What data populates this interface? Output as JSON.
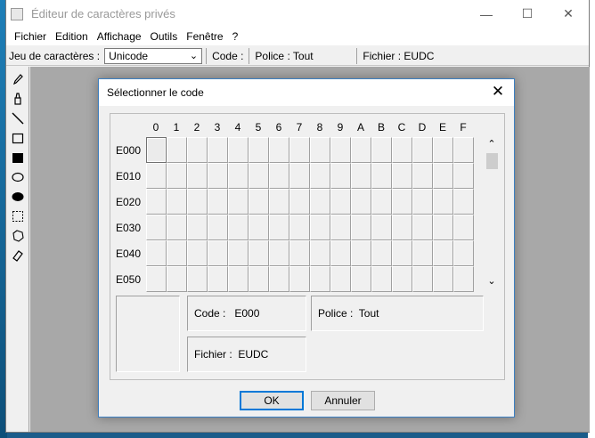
{
  "window": {
    "title": "Éditeur de caractères privés",
    "controls": {
      "minimize": "—",
      "maximize": "☐",
      "close": "✕"
    }
  },
  "menu": [
    "Fichier",
    "Edition",
    "Affichage",
    "Outils",
    "Fenêtre",
    "?"
  ],
  "toolbar": {
    "charset_label": "Jeu de caractères :",
    "charset_value": "Unicode",
    "code_label": "Code :",
    "font_label": "Police : Tout",
    "file_label": "Fichier : EUDC"
  },
  "tools": [
    "pencil-icon",
    "brush-icon",
    "line-icon",
    "hollow-rectangle-icon",
    "filled-rectangle-icon",
    "hollow-ellipse-icon",
    "filled-ellipse-icon",
    "rectangular-selection-icon",
    "freeform-selection-icon",
    "eraser-icon"
  ],
  "dialog": {
    "title": "Sélectionner le code",
    "close": "✕",
    "columns": [
      "0",
      "1",
      "2",
      "3",
      "4",
      "5",
      "6",
      "7",
      "8",
      "9",
      "A",
      "B",
      "C",
      "D",
      "E",
      "F"
    ],
    "rows": [
      "E000",
      "E010",
      "E020",
      "E030",
      "E040",
      "E050"
    ],
    "selected_code": "E000",
    "code_info": "Code :   E000",
    "font_info": "Police :  Tout",
    "file_info": "Fichier :  EUDC",
    "ok_label": "OK",
    "cancel_label": "Annuler"
  }
}
